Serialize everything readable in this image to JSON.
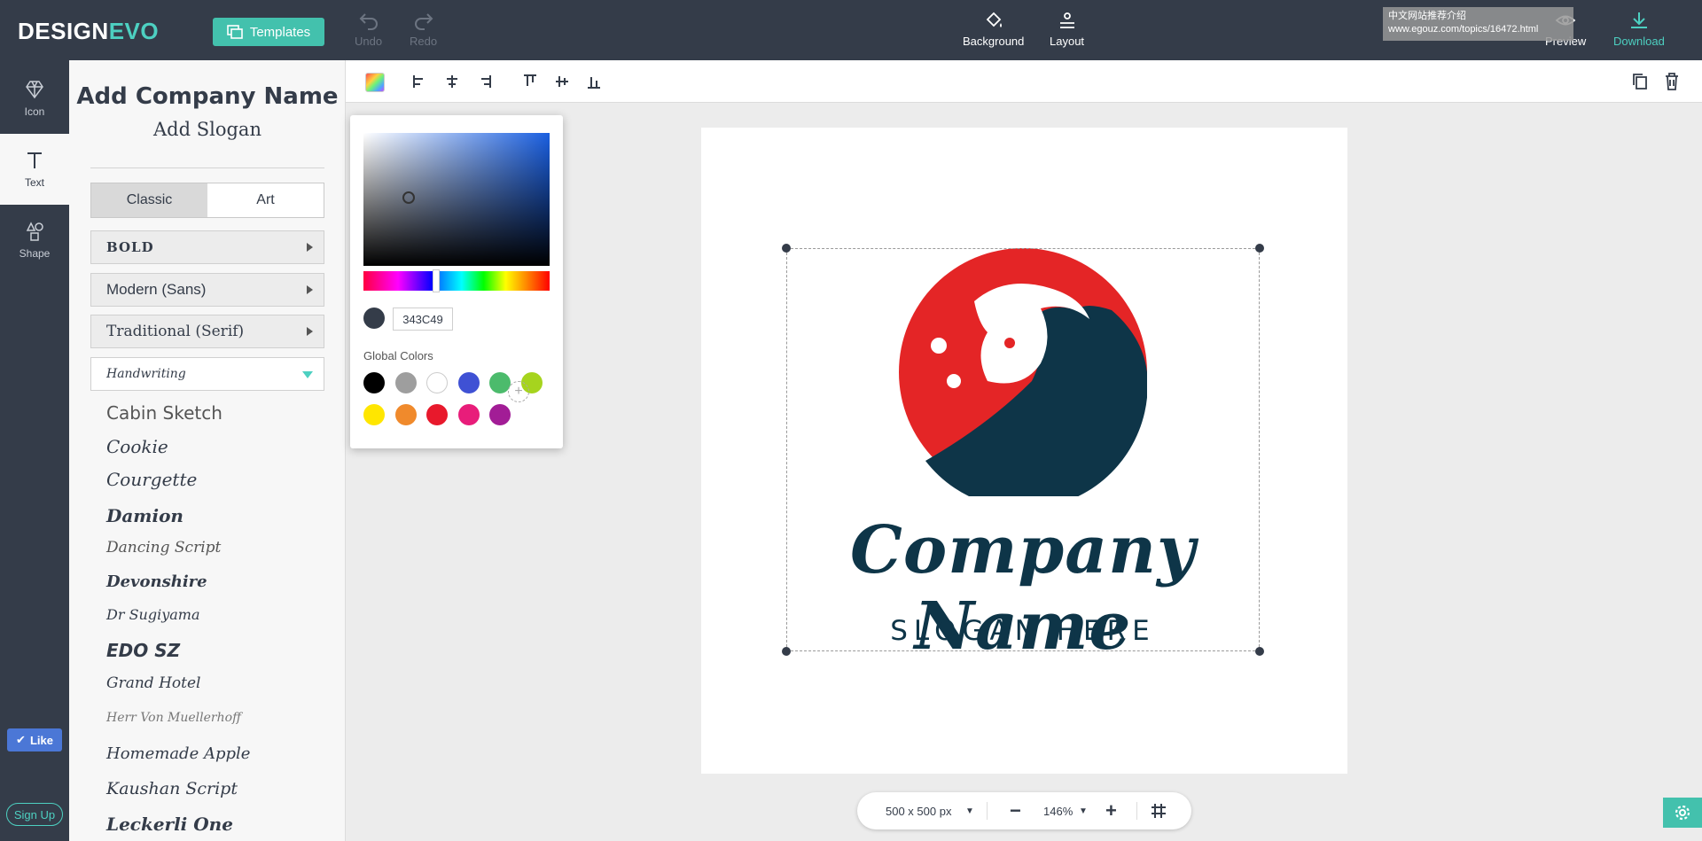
{
  "app": {
    "logo_part1": "DESIGN",
    "logo_part2": "EVO",
    "accent": "#4dd0c1",
    "dark": "#343c49"
  },
  "topbar": {
    "templates": "Templates",
    "undo": "Undo",
    "redo": "Redo",
    "background": "Background",
    "layout": "Layout",
    "preview": "Preview",
    "download": "Download",
    "watermark_line1": "中文网站推荐介绍",
    "watermark_line2": "www.egouz.com/topics/16472.html"
  },
  "rail": {
    "icon": "Icon",
    "text": "Text",
    "shape": "Shape",
    "like": "Like",
    "signup": "Sign Up"
  },
  "panel": {
    "add_company": "Add Company Name",
    "add_slogan": "Add Slogan",
    "tab_classic": "Classic",
    "tab_art": "Art",
    "categories": [
      "BOLD",
      "Modern (Sans)",
      "Traditional (Serif)",
      "Handwriting"
    ],
    "fonts": [
      "Cabin Sketch",
      "Cookie",
      "Courgette",
      "Damion",
      "Dancing Script",
      "Devonshire",
      "Dr Sugiyama",
      "EDO SZ",
      "Grand Hotel",
      "Herr Von Muellerhoff",
      "Homemade Apple",
      "Kaushan Script",
      "Leckerli One"
    ]
  },
  "picker": {
    "hex": "343C49",
    "global_colors_label": "Global Colors",
    "colors": [
      "#000000",
      "#9e9e9e",
      "#ffffff",
      "#3f51d4",
      "#4cbb6c",
      "#a6d41e",
      "#ffe600",
      "#f08a2c",
      "#e8192c",
      "#e81d7a",
      "#a21d96"
    ]
  },
  "canvas": {
    "company_name": "Company Name",
    "slogan": "SLOGAN HERE",
    "emblem_colors": [
      "#e42526",
      "#0e3548"
    ]
  },
  "zoombar": {
    "size": "500 x 500 px",
    "zoom": "146%"
  }
}
